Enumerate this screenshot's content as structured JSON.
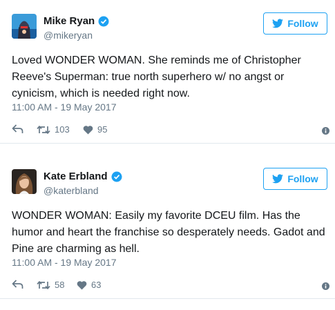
{
  "tweets": [
    {
      "name": "Mike Ryan",
      "handle": "@mikeryan",
      "follow_label": "Follow",
      "text": "Loved WONDER WOMAN. She reminds me of Christopher Reeve's Superman: true north superhero w/ no angst or cynicism, which is needed right now.",
      "time": "11:00 AM - 19 May 2017",
      "retweets": "103",
      "likes": "95"
    },
    {
      "name": "Kate Erbland",
      "handle": "@katerbland",
      "follow_label": "Follow",
      "text": "WONDER WOMAN: Easily my favorite DCEU film. Has the humor and heart the franchise so desperately needs. Gadot and Pine are charming as hell.",
      "time": "11:00 AM - 19 May 2017",
      "retweets": "58",
      "likes": "63"
    }
  ],
  "icons": {
    "verified": "verified-badge-icon",
    "follow": "bird-icon",
    "reply": "reply-icon",
    "retweet": "retweet-icon",
    "like": "heart-icon",
    "info": "info-icon"
  },
  "colors": {
    "accent": "#1da1f2",
    "secondary_text": "#657786",
    "divider": "#e1e8ed"
  }
}
